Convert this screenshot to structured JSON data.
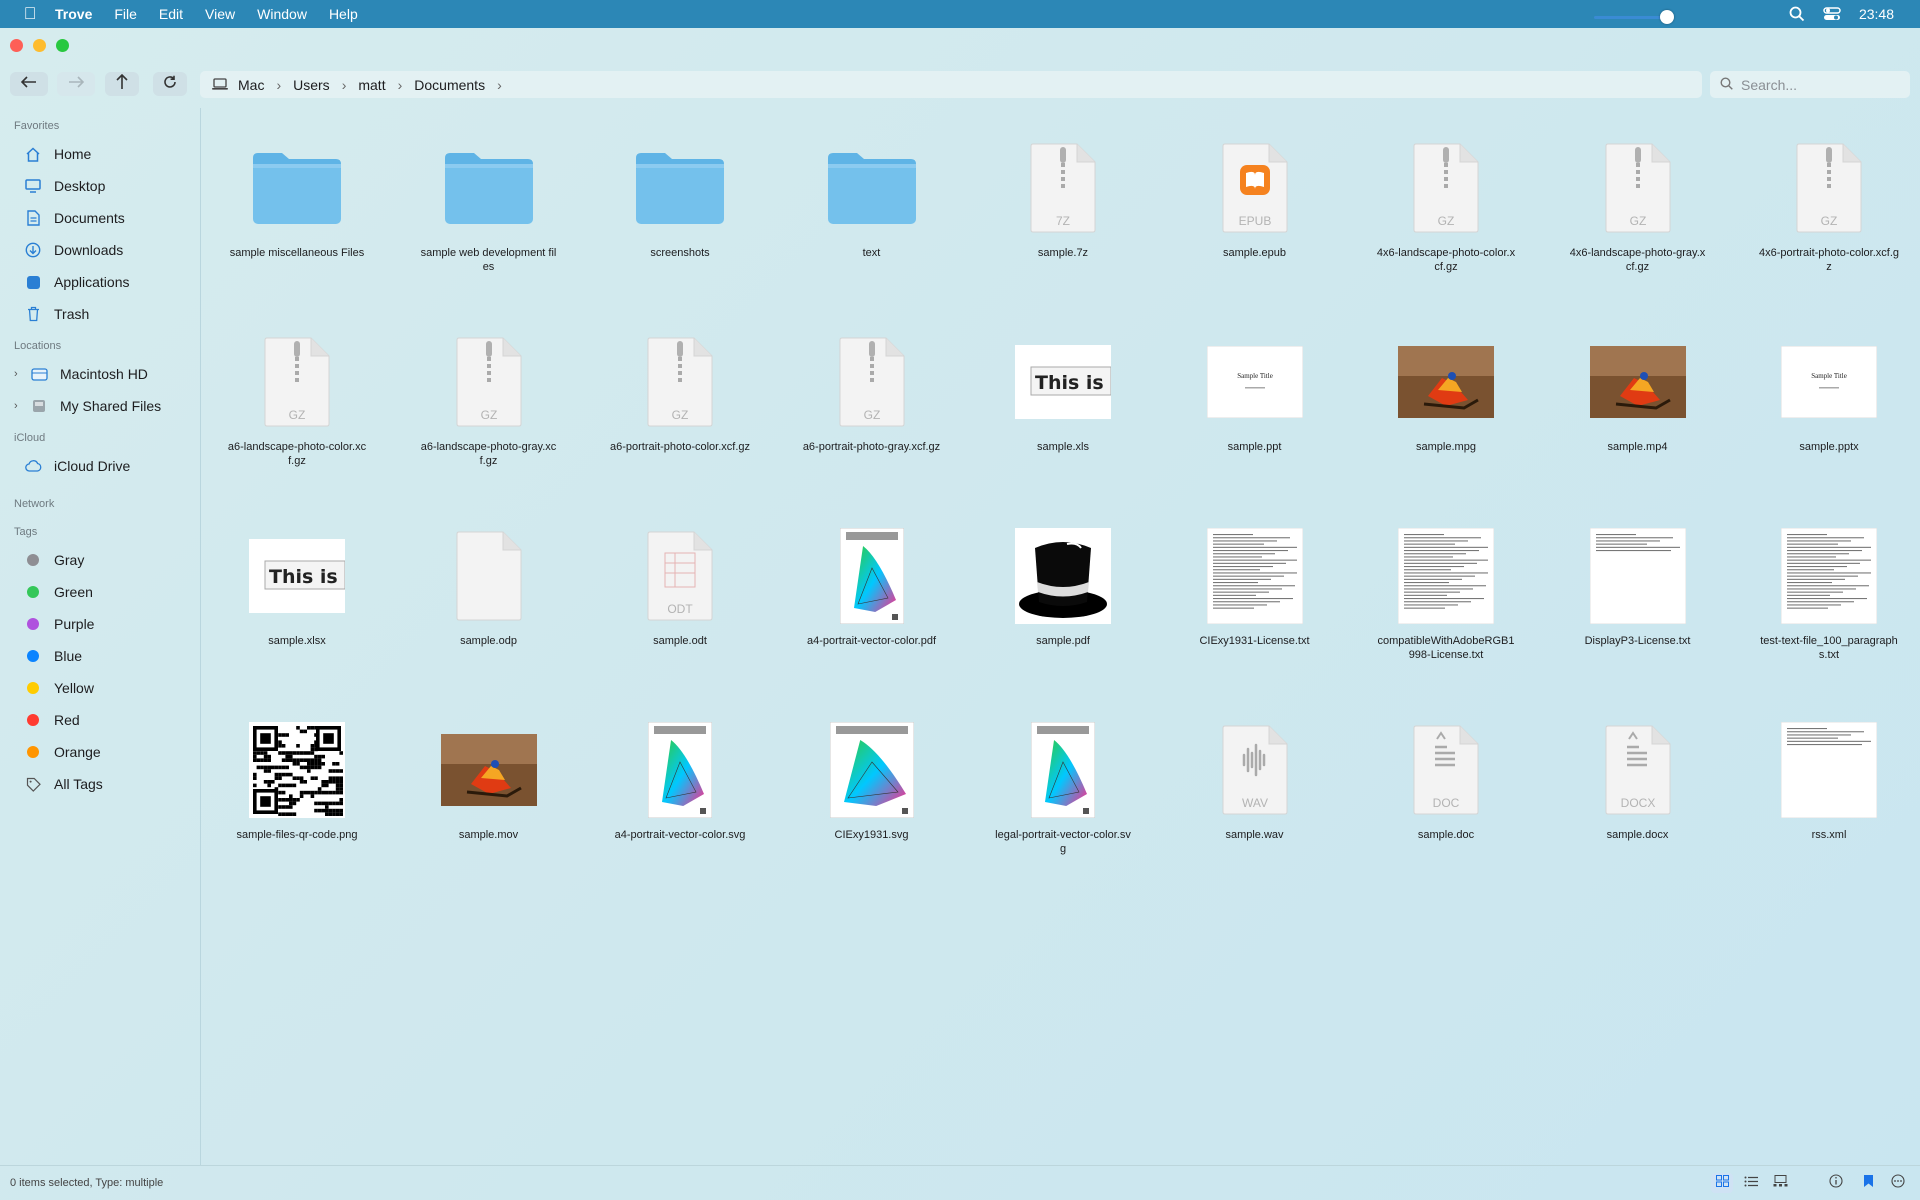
{
  "menubar": {
    "app": "Trove",
    "items": [
      "File",
      "Edit",
      "View",
      "Window",
      "Help"
    ],
    "clock": "23:48"
  },
  "path": {
    "crumbs": [
      "Mac",
      "Users",
      "matt",
      "Documents"
    ]
  },
  "search": {
    "placeholder": "Search..."
  },
  "sidebar": {
    "favorites_title": "Favorites",
    "favorites": [
      {
        "label": "Home",
        "icon": "house-icon"
      },
      {
        "label": "Desktop",
        "icon": "desktop-icon"
      },
      {
        "label": "Documents",
        "icon": "document-icon"
      },
      {
        "label": "Downloads",
        "icon": "download-icon"
      },
      {
        "label": "Applications",
        "icon": "applications-icon"
      },
      {
        "label": "Trash",
        "icon": "trash-icon"
      }
    ],
    "locations_title": "Locations",
    "locations": [
      {
        "label": "Macintosh HD",
        "icon": "harddrive-icon"
      },
      {
        "label": "My Shared Files",
        "icon": "shared-folder-icon"
      }
    ],
    "icloud_title": "iCloud",
    "icloud": [
      {
        "label": "iCloud Drive",
        "icon": "cloud-icon"
      }
    ],
    "network_title": "Network",
    "tags_title": "Tags",
    "tags": [
      {
        "label": "Gray",
        "color": "#8e8e93"
      },
      {
        "label": "Green",
        "color": "#34c759"
      },
      {
        "label": "Purple",
        "color": "#af52de"
      },
      {
        "label": "Blue",
        "color": "#0a84ff"
      },
      {
        "label": "Yellow",
        "color": "#ffcc00"
      },
      {
        "label": "Red",
        "color": "#ff3b30"
      },
      {
        "label": "Orange",
        "color": "#ff9500"
      },
      {
        "label": "All Tags",
        "color": ""
      }
    ]
  },
  "files": [
    {
      "name": "sample miscellaneous Files",
      "kind": "folder"
    },
    {
      "name": "sample web development files",
      "kind": "folder"
    },
    {
      "name": "screenshots",
      "kind": "folder"
    },
    {
      "name": "text",
      "kind": "folder"
    },
    {
      "name": "sample.7z",
      "kind": "archive",
      "ext": "7Z"
    },
    {
      "name": "sample.epub",
      "kind": "epub",
      "ext": "EPUB"
    },
    {
      "name": "4x6-landscape-photo-color.xcf.gz",
      "kind": "archive",
      "ext": "GZ"
    },
    {
      "name": "4x6-landscape-photo-gray.xcf.gz",
      "kind": "archive",
      "ext": "GZ"
    },
    {
      "name": "4x6-portrait-photo-color.xcf.gz",
      "kind": "archive",
      "ext": "GZ"
    },
    {
      "name": "a6-landscape-photo-color.xcf.gz",
      "kind": "archive",
      "ext": "GZ"
    },
    {
      "name": "a6-landscape-photo-gray.xcf.gz",
      "kind": "archive",
      "ext": "GZ"
    },
    {
      "name": "a6-portrait-photo-color.xcf.gz",
      "kind": "archive",
      "ext": "GZ"
    },
    {
      "name": "a6-portrait-photo-gray.xcf.gz",
      "kind": "archive",
      "ext": "GZ"
    },
    {
      "name": "sample.xls",
      "kind": "sheet",
      "preview": "This is"
    },
    {
      "name": "sample.ppt",
      "kind": "slide",
      "preview": "Sample Title"
    },
    {
      "name": "sample.mpg",
      "kind": "video"
    },
    {
      "name": "sample.mp4",
      "kind": "video"
    },
    {
      "name": "sample.pptx",
      "kind": "slide",
      "preview": "Sample Title"
    },
    {
      "name": "sample.xlsx",
      "kind": "sheet",
      "preview": "This is"
    },
    {
      "name": "sample.odp",
      "kind": "blank"
    },
    {
      "name": "sample.odt",
      "kind": "odt",
      "ext": "ODT"
    },
    {
      "name": "a4-portrait-vector-color.pdf",
      "kind": "chroma"
    },
    {
      "name": "sample.pdf",
      "kind": "hat"
    },
    {
      "name": "CIExy1931-License.txt",
      "kind": "text"
    },
    {
      "name": "compatibleWithAdobeRGB1998-License.txt",
      "kind": "text"
    },
    {
      "name": "DisplayP3-License.txt",
      "kind": "text-short"
    },
    {
      "name": "test-text-file_100_paragraphs.txt",
      "kind": "text"
    },
    {
      "name": "sample-files-qr-code.png",
      "kind": "qr"
    },
    {
      "name": "sample.mov",
      "kind": "video"
    },
    {
      "name": "a4-portrait-vector-color.svg",
      "kind": "chroma"
    },
    {
      "name": "CIExy1931.svg",
      "kind": "cie"
    },
    {
      "name": "legal-portrait-vector-color.svg",
      "kind": "chroma"
    },
    {
      "name": "sample.wav",
      "kind": "audio",
      "ext": "WAV"
    },
    {
      "name": "sample.doc",
      "kind": "doc",
      "ext": "DOC"
    },
    {
      "name": "sample.docx",
      "kind": "doc",
      "ext": "DOCX"
    },
    {
      "name": "rss.xml",
      "kind": "text-short"
    }
  ],
  "status": {
    "text": "0 items selected, Type: multiple"
  },
  "zoom_level": 0.85
}
